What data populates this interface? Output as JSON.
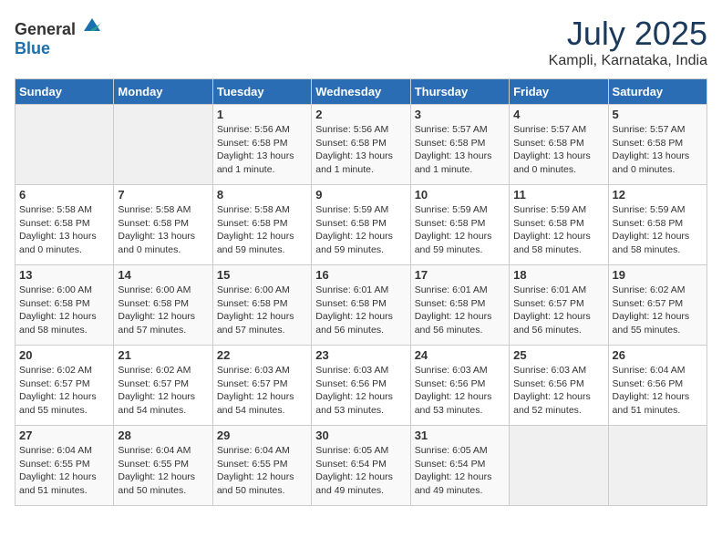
{
  "logo": {
    "text_general": "General",
    "text_blue": "Blue"
  },
  "title": {
    "month_year": "July 2025",
    "location": "Kampli, Karnataka, India"
  },
  "weekdays": [
    "Sunday",
    "Monday",
    "Tuesday",
    "Wednesday",
    "Thursday",
    "Friday",
    "Saturday"
  ],
  "weeks": [
    [
      {
        "day": "",
        "detail": ""
      },
      {
        "day": "",
        "detail": ""
      },
      {
        "day": "1",
        "detail": "Sunrise: 5:56 AM\nSunset: 6:58 PM\nDaylight: 13 hours and 1 minute."
      },
      {
        "day": "2",
        "detail": "Sunrise: 5:56 AM\nSunset: 6:58 PM\nDaylight: 13 hours and 1 minute."
      },
      {
        "day": "3",
        "detail": "Sunrise: 5:57 AM\nSunset: 6:58 PM\nDaylight: 13 hours and 1 minute."
      },
      {
        "day": "4",
        "detail": "Sunrise: 5:57 AM\nSunset: 6:58 PM\nDaylight: 13 hours and 0 minutes."
      },
      {
        "day": "5",
        "detail": "Sunrise: 5:57 AM\nSunset: 6:58 PM\nDaylight: 13 hours and 0 minutes."
      }
    ],
    [
      {
        "day": "6",
        "detail": "Sunrise: 5:58 AM\nSunset: 6:58 PM\nDaylight: 13 hours and 0 minutes."
      },
      {
        "day": "7",
        "detail": "Sunrise: 5:58 AM\nSunset: 6:58 PM\nDaylight: 13 hours and 0 minutes."
      },
      {
        "day": "8",
        "detail": "Sunrise: 5:58 AM\nSunset: 6:58 PM\nDaylight: 12 hours and 59 minutes."
      },
      {
        "day": "9",
        "detail": "Sunrise: 5:59 AM\nSunset: 6:58 PM\nDaylight: 12 hours and 59 minutes."
      },
      {
        "day": "10",
        "detail": "Sunrise: 5:59 AM\nSunset: 6:58 PM\nDaylight: 12 hours and 59 minutes."
      },
      {
        "day": "11",
        "detail": "Sunrise: 5:59 AM\nSunset: 6:58 PM\nDaylight: 12 hours and 58 minutes."
      },
      {
        "day": "12",
        "detail": "Sunrise: 5:59 AM\nSunset: 6:58 PM\nDaylight: 12 hours and 58 minutes."
      }
    ],
    [
      {
        "day": "13",
        "detail": "Sunrise: 6:00 AM\nSunset: 6:58 PM\nDaylight: 12 hours and 58 minutes."
      },
      {
        "day": "14",
        "detail": "Sunrise: 6:00 AM\nSunset: 6:58 PM\nDaylight: 12 hours and 57 minutes."
      },
      {
        "day": "15",
        "detail": "Sunrise: 6:00 AM\nSunset: 6:58 PM\nDaylight: 12 hours and 57 minutes."
      },
      {
        "day": "16",
        "detail": "Sunrise: 6:01 AM\nSunset: 6:58 PM\nDaylight: 12 hours and 56 minutes."
      },
      {
        "day": "17",
        "detail": "Sunrise: 6:01 AM\nSunset: 6:58 PM\nDaylight: 12 hours and 56 minutes."
      },
      {
        "day": "18",
        "detail": "Sunrise: 6:01 AM\nSunset: 6:57 PM\nDaylight: 12 hours and 56 minutes."
      },
      {
        "day": "19",
        "detail": "Sunrise: 6:02 AM\nSunset: 6:57 PM\nDaylight: 12 hours and 55 minutes."
      }
    ],
    [
      {
        "day": "20",
        "detail": "Sunrise: 6:02 AM\nSunset: 6:57 PM\nDaylight: 12 hours and 55 minutes."
      },
      {
        "day": "21",
        "detail": "Sunrise: 6:02 AM\nSunset: 6:57 PM\nDaylight: 12 hours and 54 minutes."
      },
      {
        "day": "22",
        "detail": "Sunrise: 6:03 AM\nSunset: 6:57 PM\nDaylight: 12 hours and 54 minutes."
      },
      {
        "day": "23",
        "detail": "Sunrise: 6:03 AM\nSunset: 6:56 PM\nDaylight: 12 hours and 53 minutes."
      },
      {
        "day": "24",
        "detail": "Sunrise: 6:03 AM\nSunset: 6:56 PM\nDaylight: 12 hours and 53 minutes."
      },
      {
        "day": "25",
        "detail": "Sunrise: 6:03 AM\nSunset: 6:56 PM\nDaylight: 12 hours and 52 minutes."
      },
      {
        "day": "26",
        "detail": "Sunrise: 6:04 AM\nSunset: 6:56 PM\nDaylight: 12 hours and 51 minutes."
      }
    ],
    [
      {
        "day": "27",
        "detail": "Sunrise: 6:04 AM\nSunset: 6:55 PM\nDaylight: 12 hours and 51 minutes."
      },
      {
        "day": "28",
        "detail": "Sunrise: 6:04 AM\nSunset: 6:55 PM\nDaylight: 12 hours and 50 minutes."
      },
      {
        "day": "29",
        "detail": "Sunrise: 6:04 AM\nSunset: 6:55 PM\nDaylight: 12 hours and 50 minutes."
      },
      {
        "day": "30",
        "detail": "Sunrise: 6:05 AM\nSunset: 6:54 PM\nDaylight: 12 hours and 49 minutes."
      },
      {
        "day": "31",
        "detail": "Sunrise: 6:05 AM\nSunset: 6:54 PM\nDaylight: 12 hours and 49 minutes."
      },
      {
        "day": "",
        "detail": ""
      },
      {
        "day": "",
        "detail": ""
      }
    ]
  ]
}
